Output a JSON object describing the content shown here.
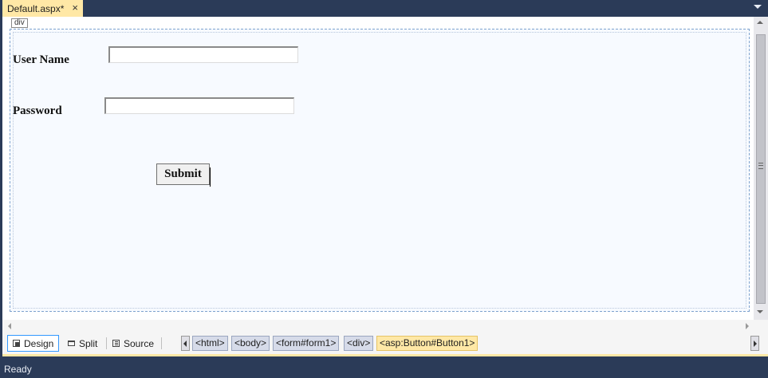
{
  "tab": {
    "title": "Default.aspx*",
    "close_icon": "×"
  },
  "designer": {
    "div_tag": "div",
    "username_label": "User Name",
    "username_value": "",
    "password_label": "Password",
    "password_value": "",
    "submit_label": "Submit"
  },
  "view_switcher": [
    {
      "label": "Design",
      "icon": "design-view-icon",
      "active": true
    },
    {
      "label": "Split",
      "icon": "split-view-icon",
      "active": false
    },
    {
      "label": "Source",
      "icon": "source-view-icon",
      "active": false
    }
  ],
  "breadcrumbs": [
    "<html>",
    "<body>",
    "<form#form1>",
    "<div>",
    "<asp:Button#Button1>"
  ],
  "status": "Ready"
}
